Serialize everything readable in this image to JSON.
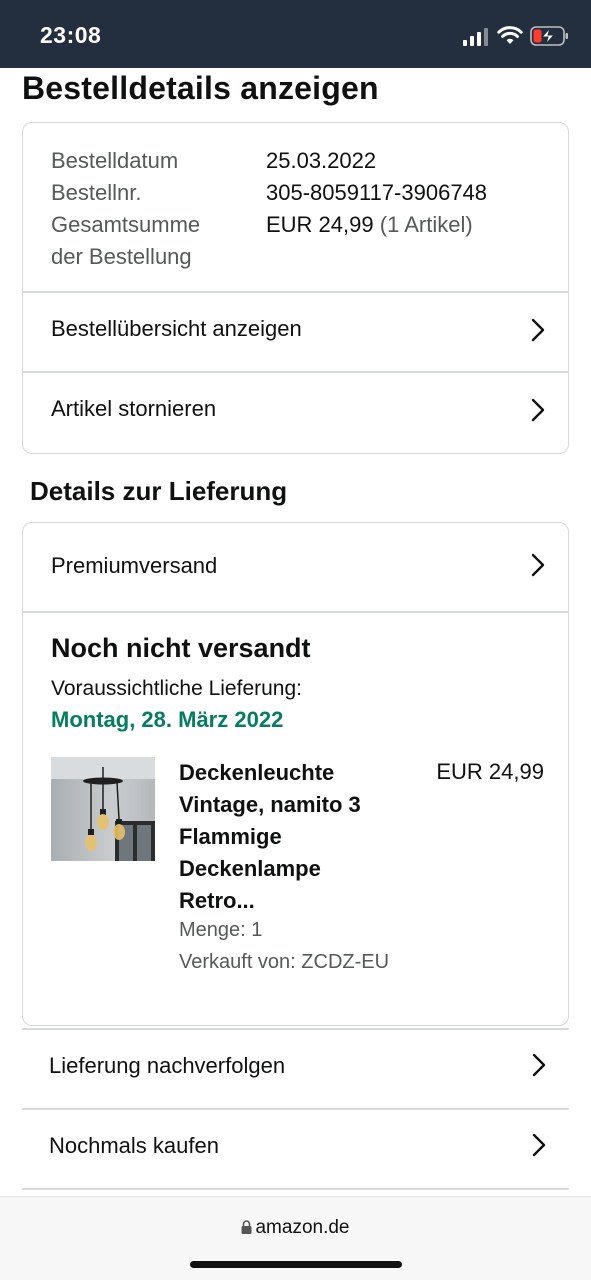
{
  "status_bar": {
    "time": "23:08"
  },
  "page_title": "Bestelldetails anzeigen",
  "order_summary": {
    "date_label": "Bestelldatum",
    "date_value": "25.03.2022",
    "number_label": "Bestellnr.",
    "number_value": "305-8059117-3906748",
    "total_label_1": "Gesamtsumme",
    "total_label_2": "der Bestellung",
    "total_value": "EUR 24,99",
    "total_items": "(1 Artikel)",
    "links": [
      {
        "label": "Bestellübersicht anzeigen"
      },
      {
        "label": "Artikel stornieren"
      }
    ]
  },
  "delivery": {
    "section_title": "Details zur Lieferung",
    "shipping_method": "Premiumversand",
    "status": "Noch nicht versandt",
    "eta_label": "Voraussichtliche Lieferung:",
    "eta_date": "Montag, 28. März 2022",
    "eta_color": "#067d62",
    "item": {
      "title_lines": [
        "Deckenleuchte",
        "Vintage, namito 3",
        "Flammige",
        "Deckenlampe",
        "Retro..."
      ],
      "price": "EUR 24,99",
      "quantity": "Menge: 1",
      "seller": "Verkauft von: ZCDZ-EU"
    }
  },
  "actions": [
    {
      "label": "Lieferung nachverfolgen"
    },
    {
      "label": "Nochmals kaufen"
    }
  ],
  "browser": {
    "domain": "amazon.de"
  }
}
